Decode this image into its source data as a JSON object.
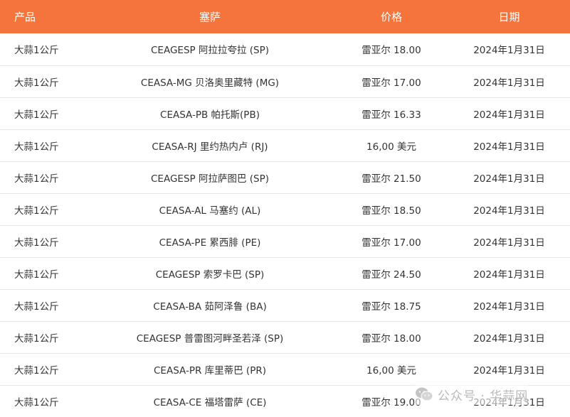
{
  "table": {
    "headers": [
      "产品",
      "塞萨",
      "价格",
      "日期"
    ],
    "rows": [
      [
        "大蒜1公斤",
        "CEAGESP 阿拉拉夸拉 (SP)",
        "雷亚尔 18.00",
        "2024年1月31日"
      ],
      [
        "大蒜1公斤",
        "CEASA-MG 贝洛奥里藏特 (MG)",
        "雷亚尔 17.00",
        "2024年1月31日"
      ],
      [
        "大蒜1公斤",
        "CEASA-PB 帕托斯(PB)",
        "雷亚尔 16.33",
        "2024年1月31日"
      ],
      [
        "大蒜1公斤",
        "CEASA-RJ 里约热内卢 (RJ)",
        "16,00 美元",
        "2024年1月31日"
      ],
      [
        "大蒜1公斤",
        "CEAGESP 阿拉萨图巴 (SP)",
        "雷亚尔 21.50",
        "2024年1月31日"
      ],
      [
        "大蒜1公斤",
        "CEASA-AL 马塞约 (AL)",
        "雷亚尔 18.50",
        "2024年1月31日"
      ],
      [
        "大蒜1公斤",
        "CEASA-PE 累西腓 (PE)",
        "雷亚尔 17.00",
        "2024年1月31日"
      ],
      [
        "大蒜1公斤",
        "CEAGESP 索罗卡巴 (SP)",
        "雷亚尔 24.50",
        "2024年1月31日"
      ],
      [
        "大蒜1公斤",
        "CEASA-BA 茹阿泽鲁 (BA)",
        "雷亚尔 18.75",
        "2024年1月31日"
      ],
      [
        "大蒜1公斤",
        "CEAGESP 普雷图河畔圣若泽 (SP)",
        "雷亚尔 18.00",
        "2024年1月31日"
      ],
      [
        "大蒜1公斤",
        "CEASA-PR 库里蒂巴 (PR)",
        "16,00 美元",
        "2024年1月31日"
      ],
      [
        "大蒜1公斤",
        "CEASA-CE 福塔雷萨 (CE)",
        "雷亚尔 19.00",
        "2024年1月31日"
      ]
    ]
  },
  "watermark": {
    "text": "公众号 · 华蒜网",
    "icon": "wechat-icon"
  },
  "colors": {
    "header_bg": "#f4743b",
    "header_text": "#ffffff",
    "row_border": "#e6e6e6"
  }
}
